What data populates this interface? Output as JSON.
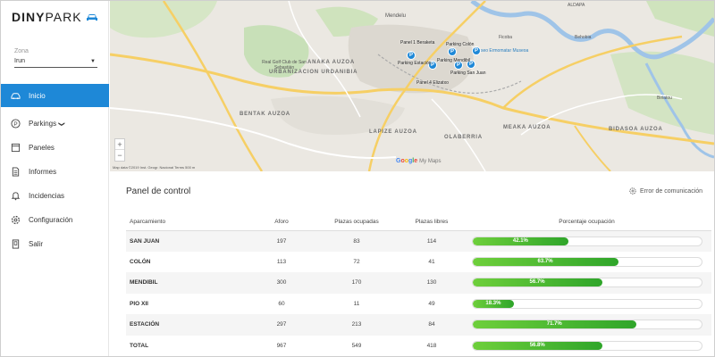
{
  "app": {
    "logo_main": "DINY",
    "logo_second": "PARK"
  },
  "zone": {
    "label": "Zona",
    "value": "Irun"
  },
  "nav": {
    "items": [
      {
        "label": "Inicio",
        "icon": "car-icon",
        "active": true
      },
      {
        "label": "Parkings",
        "icon": "parking-icon",
        "chevron": "❯"
      },
      {
        "label": "Paneles",
        "icon": "panel-icon"
      },
      {
        "label": "Informes",
        "icon": "document-icon"
      },
      {
        "label": "Incidencias",
        "icon": "bell-icon"
      },
      {
        "label": "Configuración",
        "icon": "gear-icon"
      },
      {
        "label": "Salir",
        "icon": "exit-icon"
      }
    ]
  },
  "map": {
    "areas": [
      "URBANIZACION URDANIBIA",
      "ANAKA AUZOA",
      "BENTAK AUZOA",
      "LAPIZE AUZOA",
      "OLABERRIA",
      "MEAKA AUZOA",
      "BIDASOA AUZOA",
      "ALDAPA",
      "Behobia",
      "Biriatou",
      "Mendelu"
    ],
    "places": [
      "Real Golf Club de San Sebastián",
      "Ficoba",
      "Museo Ermomatar Museoa"
    ],
    "parkings": [
      "Panel 1 Beraketa",
      "Parking Estación",
      "Parking Mendibil",
      "Parking San Juan",
      "Panel 4 Elizatxo",
      "Parking Colón"
    ],
    "zoom_in": "+",
    "zoom_out": "−",
    "attribution": "Map data ©2019 Inst. Geogr. Nacional  Terms  500 m",
    "google": [
      "G",
      "o",
      "o",
      "g",
      "l",
      "e"
    ],
    "mymaps": "My Maps"
  },
  "panel": {
    "title": "Panel de control",
    "comm_status": "Error de comunicación",
    "columns": [
      "Aparcamiento",
      "Aforo",
      "Plazas ocupadas",
      "Plazas libres",
      "Porcentaje ocupación"
    ],
    "rows": [
      {
        "name": "SAN JUAN",
        "aforo": "197",
        "ocupadas": "83",
        "libres": "114",
        "pct": 42.1,
        "pct_label": "42.1%"
      },
      {
        "name": "COLÓN",
        "aforo": "113",
        "ocupadas": "72",
        "libres": "41",
        "pct": 63.7,
        "pct_label": "63.7%"
      },
      {
        "name": "MENDIBIL",
        "aforo": "300",
        "ocupadas": "170",
        "libres": "130",
        "pct": 56.7,
        "pct_label": "56.7%"
      },
      {
        "name": "PIO XII",
        "aforo": "60",
        "ocupadas": "11",
        "libres": "49",
        "pct": 18.3,
        "pct_label": "18.3%"
      },
      {
        "name": "ESTACIÓN",
        "aforo": "297",
        "ocupadas": "213",
        "libres": "84",
        "pct": 71.7,
        "pct_label": "71.7%"
      },
      {
        "name": "TOTAL",
        "aforo": "967",
        "ocupadas": "549",
        "libres": "418",
        "pct": 56.8,
        "pct_label": "56.8%"
      }
    ]
  },
  "colors": {
    "accent": "#1e88d7",
    "bar_start": "#6ecf3b",
    "bar_end": "#2fa52a"
  }
}
